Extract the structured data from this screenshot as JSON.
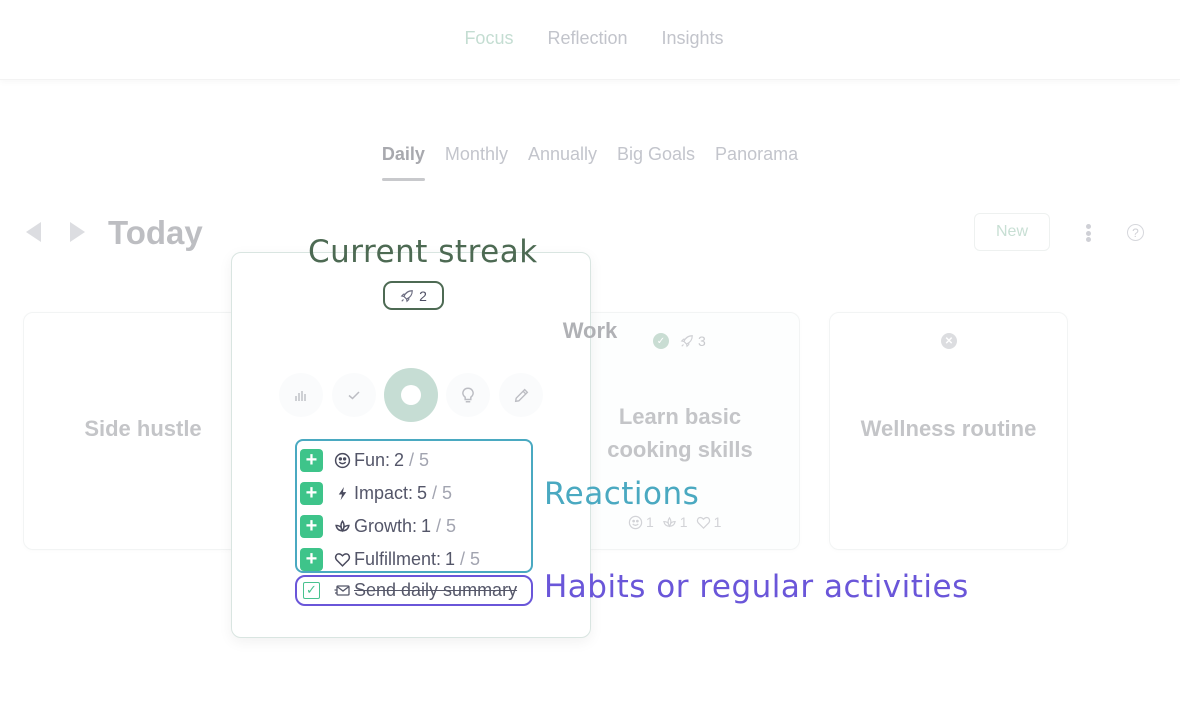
{
  "top_nav": {
    "items": [
      {
        "label": "Focus",
        "active": true
      },
      {
        "label": "Reflection",
        "active": false
      },
      {
        "label": "Insights",
        "active": false
      }
    ]
  },
  "sub_tabs": [
    {
      "label": "Daily",
      "active": true
    },
    {
      "label": "Monthly",
      "active": false
    },
    {
      "label": "Annually",
      "active": false
    },
    {
      "label": "Big Goals",
      "active": false
    },
    {
      "label": "Panorama",
      "active": false
    }
  ],
  "header": {
    "title": "Today",
    "new_button": "New",
    "help_glyph": "?"
  },
  "cards": {
    "side_hustle": {
      "title": "Side hustle"
    },
    "learn": {
      "title_line1": "Learn basic",
      "title_line2": "cooking skills",
      "status": "completed",
      "streak": "3",
      "reactions": [
        {
          "icon": "smile-icon",
          "count": "1"
        },
        {
          "icon": "lotus-icon",
          "count": "1"
        },
        {
          "icon": "heart-icon",
          "count": "1"
        }
      ]
    },
    "wellness": {
      "title": "Wellness routine",
      "status": "skipped"
    }
  },
  "work_card": {
    "title": "Work",
    "streak": "2",
    "actions": [
      {
        "name": "stats",
        "icon": "bar-chart-icon"
      },
      {
        "name": "complete",
        "icon": "check-icon"
      },
      {
        "name": "focus",
        "icon": "record-icon"
      },
      {
        "name": "idea",
        "icon": "lightbulb-icon"
      },
      {
        "name": "edit",
        "icon": "pencil-icon"
      }
    ],
    "reactions": [
      {
        "label": "Fun:",
        "value": "2",
        "max": "/ 5",
        "icon": "smile-icon"
      },
      {
        "label": "Impact:",
        "value": "5",
        "max": "/ 5",
        "icon": "bolt-icon"
      },
      {
        "label": "Growth:",
        "value": "1",
        "max": "/ 5",
        "icon": "lotus-icon"
      },
      {
        "label": "Fulfillment:",
        "value": "1",
        "max": "/ 5",
        "icon": "heart-icon"
      }
    ],
    "habit": {
      "label": "Send daily summary",
      "done": true,
      "icon": "mail-icon"
    }
  },
  "annotations": {
    "streak": "Current streak",
    "reactions": "Reactions",
    "habits": "Habits or regular activities"
  },
  "colors": {
    "accent_green": "#3ec48a",
    "focus_mint": "#c6ddd4",
    "annot_streak": "#4d6a53",
    "annot_reactions": "#4aa9c1",
    "annot_habits": "#6a56d9"
  }
}
